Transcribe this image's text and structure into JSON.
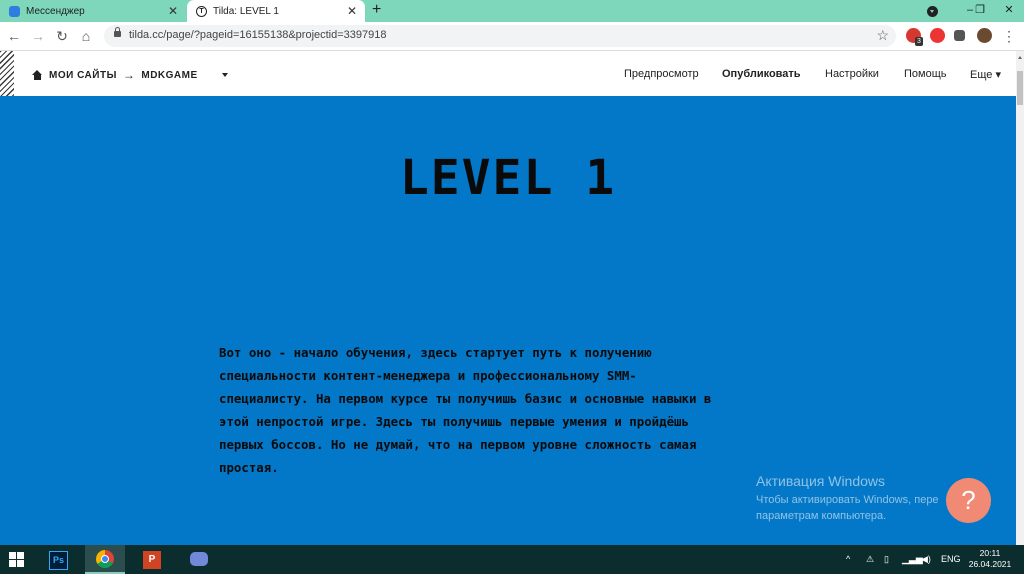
{
  "browser": {
    "tabs": [
      {
        "title": "Мессенджер",
        "favicon_color": "#2f7de1"
      },
      {
        "title": "Tilda: LEVEL 1",
        "favicon_letter": "T"
      }
    ],
    "new_tab_label": "+",
    "url": "tilda.cc/page/?pageid=16155138&projectid=3397918",
    "extension_badge": "3",
    "window_controls": {
      "minimize": "–",
      "restore": "❐",
      "close": "✕"
    }
  },
  "tilda": {
    "breadcrumb_home": "МОИ САЙТЫ",
    "breadcrumb_arrow": "→",
    "breadcrumb_site": "MDKGAME",
    "menu": [
      "Предпросмотр",
      "Опубликовать",
      "Настройки",
      "Помощь",
      "Еще"
    ],
    "menu_caret": "▾"
  },
  "page": {
    "heading": "LEVEL 1",
    "paragraph_lines": [
      "Вот оно - начало обучения, здесь стартует путь к получению",
      "специальности контент-менеджера и профессиональному SMM-",
      "специалисту. На первом курсе ты получишь базис и основные навыки в",
      "этой непростой игре. Здесь ты получишь первые умения и пройдёшь",
      "первых боссов. Но не думай, что на первом уровне сложность самая",
      "простая."
    ],
    "background_color": "#0478c8"
  },
  "activation": {
    "title": "Активация Windows",
    "line1": "Чтобы активировать Windows, пере",
    "line2": "параметрам компьютера."
  },
  "help_button": "?",
  "taskbar": {
    "apps": [
      "start-icon",
      "photoshop-icon",
      "chrome-icon",
      "powerpoint-icon",
      "discord-icon"
    ],
    "ps_label": "Ps",
    "ppt_label": "P",
    "tray_caret": "^",
    "language": "ENG",
    "time": "20:11",
    "date": "26.04.2021"
  }
}
